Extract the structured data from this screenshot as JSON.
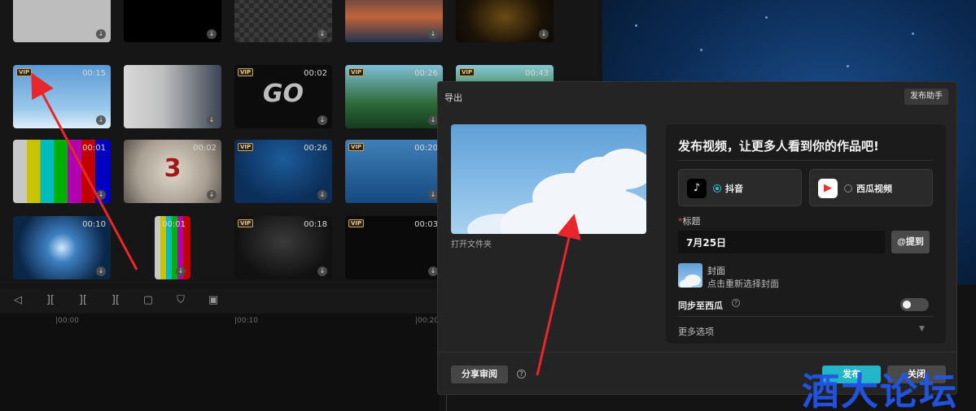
{
  "media": {
    "clips": [
      {
        "vip": "",
        "duration": "",
        "style": "gray"
      },
      {
        "vip": "",
        "duration": "",
        "style": "black"
      },
      {
        "vip": "",
        "duration": "",
        "style": "checker"
      },
      {
        "vip": "",
        "duration": "",
        "style": "sunset"
      },
      {
        "vip": "",
        "duration": "",
        "style": "gold-ring"
      },
      {
        "vip": "VIP",
        "duration": "00:15",
        "style": "sky"
      },
      {
        "vip": "",
        "duration": "",
        "style": "portrait"
      },
      {
        "vip": "VIP",
        "duration": "00:02",
        "style": "go",
        "text": "GO"
      },
      {
        "vip": "VIP",
        "duration": "00:26",
        "style": "forest"
      },
      {
        "vip": "VIP",
        "duration": "00:43",
        "style": "forest2"
      },
      {
        "vip": "",
        "duration": "00:01",
        "style": "colorbars"
      },
      {
        "vip": "",
        "duration": "00:02",
        "style": "countdown",
        "text": "3"
      },
      {
        "vip": "VIP",
        "duration": "00:26",
        "style": "underwater"
      },
      {
        "vip": "VIP",
        "duration": "00:20",
        "style": "bluewater"
      },
      {
        "vip": "",
        "duration": "",
        "style": "bluewater2"
      },
      {
        "vip": "",
        "duration": "00:10",
        "style": "burst"
      },
      {
        "vip": "",
        "duration": "00:01",
        "style": "colorbars2"
      },
      {
        "vip": "VIP",
        "duration": "00:18",
        "style": "darkfog"
      },
      {
        "vip": "VIP",
        "duration": "00:03",
        "style": "calligraphy"
      }
    ]
  },
  "timeline": {
    "ticks": [
      "|00:00",
      "|00:10",
      "|00:20"
    ],
    "tools": [
      "undo-icon",
      "split-icon",
      "trim-left-icon",
      "trim-right-icon",
      "delete-icon",
      "mark-icon",
      "freeze-icon"
    ]
  },
  "dialog": {
    "title": "导出",
    "assistant_label": "发布助手",
    "open_folder_label": "打开文件夹",
    "headline": "发布视频，让更多人看到你的作品吧!",
    "platforms": [
      {
        "name": "抖音",
        "selected": true,
        "icon": "douyin-icon"
      },
      {
        "name": "西瓜视频",
        "selected": false,
        "icon": "xigua-icon"
      }
    ],
    "title_required_mark": "*",
    "title_label": "标题",
    "title_value": "7月25日",
    "mention_label": "@提到",
    "cover_label": "封面",
    "cover_hint": "点击重新选择封面",
    "sync_label": "同步至西瓜",
    "sync_enabled": false,
    "more_options_label": "更多选项",
    "share_review_label": "分享审阅",
    "publish_label": "发布",
    "close_label": "关闭"
  },
  "watermark": "酒大论坛",
  "colors": {
    "accent": "#23b6c9",
    "arrow": "#e8262b",
    "watermark": "#2256e8"
  }
}
